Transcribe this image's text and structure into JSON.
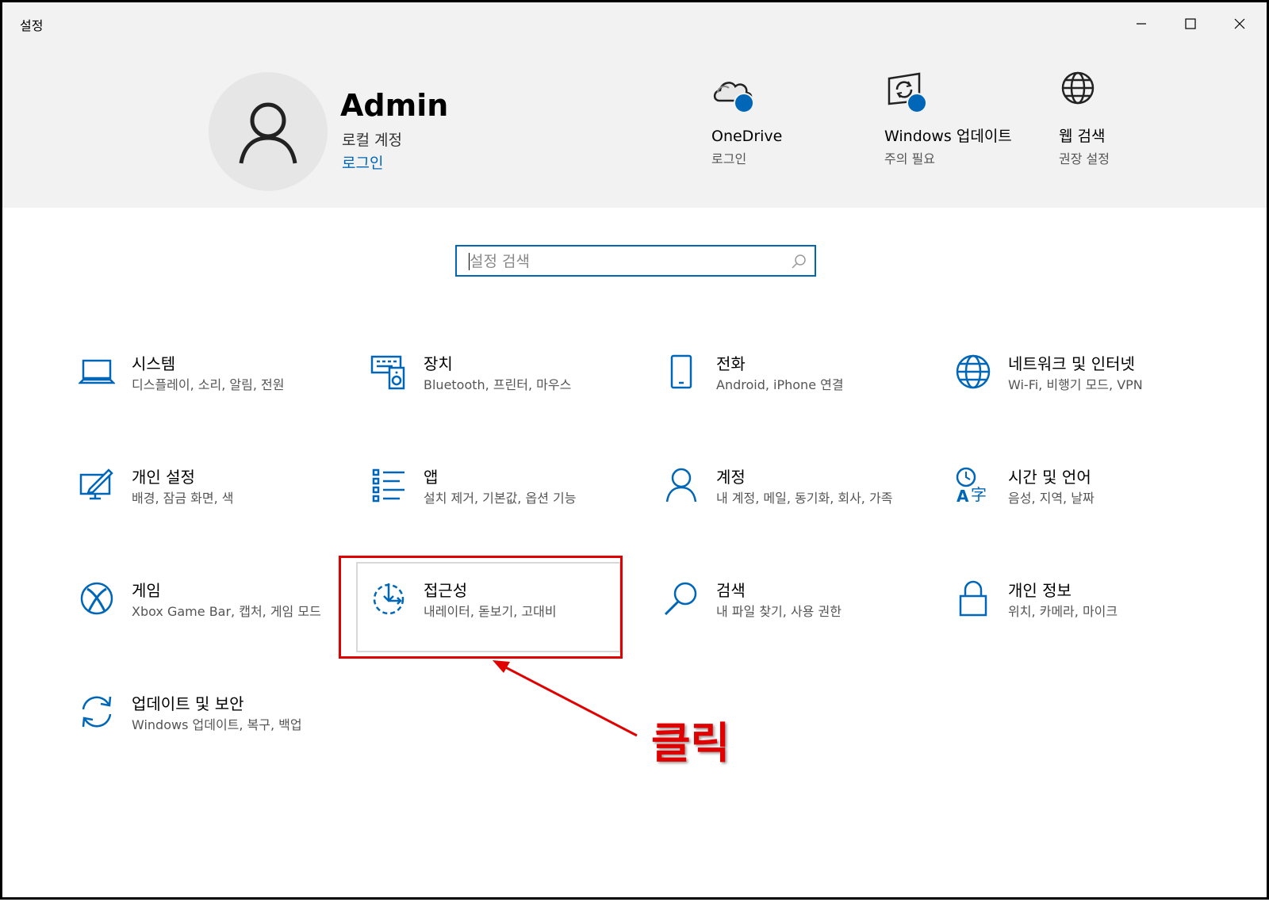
{
  "window": {
    "title": "설정"
  },
  "header": {
    "user_name": "Admin",
    "account_type": "로컬 계정",
    "signin_link": "로그인",
    "status_items": [
      {
        "title": "OneDrive",
        "subtitle": "로그인",
        "icon": "cloud-icon"
      },
      {
        "title": "Windows 업데이트",
        "subtitle": "주의 필요",
        "icon": "windows-update-icon"
      },
      {
        "title": "웹 검색",
        "subtitle": "권장 설정",
        "icon": "globe-icon"
      }
    ]
  },
  "search": {
    "placeholder": "설정 검색"
  },
  "categories": [
    {
      "name": "시스템",
      "desc": "디스플레이, 소리, 알림, 전원",
      "icon": "laptop-icon"
    },
    {
      "name": "장치",
      "desc": "Bluetooth, 프린터, 마우스",
      "icon": "devices-icon"
    },
    {
      "name": "전화",
      "desc": "Android, iPhone 연결",
      "icon": "phone-icon"
    },
    {
      "name": "네트워크 및 인터넷",
      "desc": "Wi-Fi, 비행기 모드, VPN",
      "icon": "globe-icon"
    },
    {
      "name": "개인 설정",
      "desc": "배경, 잠금 화면, 색",
      "icon": "personalization-icon"
    },
    {
      "name": "앱",
      "desc": "설치 제거, 기본값, 옵션 기능",
      "icon": "apps-list-icon"
    },
    {
      "name": "계정",
      "desc": "내 계정, 메일, 동기화, 회사, 가족",
      "icon": "person-icon"
    },
    {
      "name": "시간 및 언어",
      "desc": "음성, 지역, 날짜",
      "icon": "time-language-icon"
    },
    {
      "name": "게임",
      "desc": "Xbox Game Bar, 캡처, 게임 모드",
      "icon": "xbox-icon"
    },
    {
      "name": "접근성",
      "desc": "내레이터, 돋보기, 고대비",
      "icon": "accessibility-icon"
    },
    {
      "name": "검색",
      "desc": "내 파일 찾기, 사용 권한",
      "icon": "magnifier-icon"
    },
    {
      "name": "개인 정보",
      "desc": "위치, 카메라, 마이크",
      "icon": "lock-icon"
    },
    {
      "name": "업데이트 및 보안",
      "desc": "Windows 업데이트, 복구, 백업",
      "icon": "sync-icon"
    }
  ],
  "annotation": {
    "text": "클릭",
    "color": "#e00000"
  },
  "colors": {
    "accent": "#0067b8",
    "header_bg": "#f2f2f2"
  }
}
